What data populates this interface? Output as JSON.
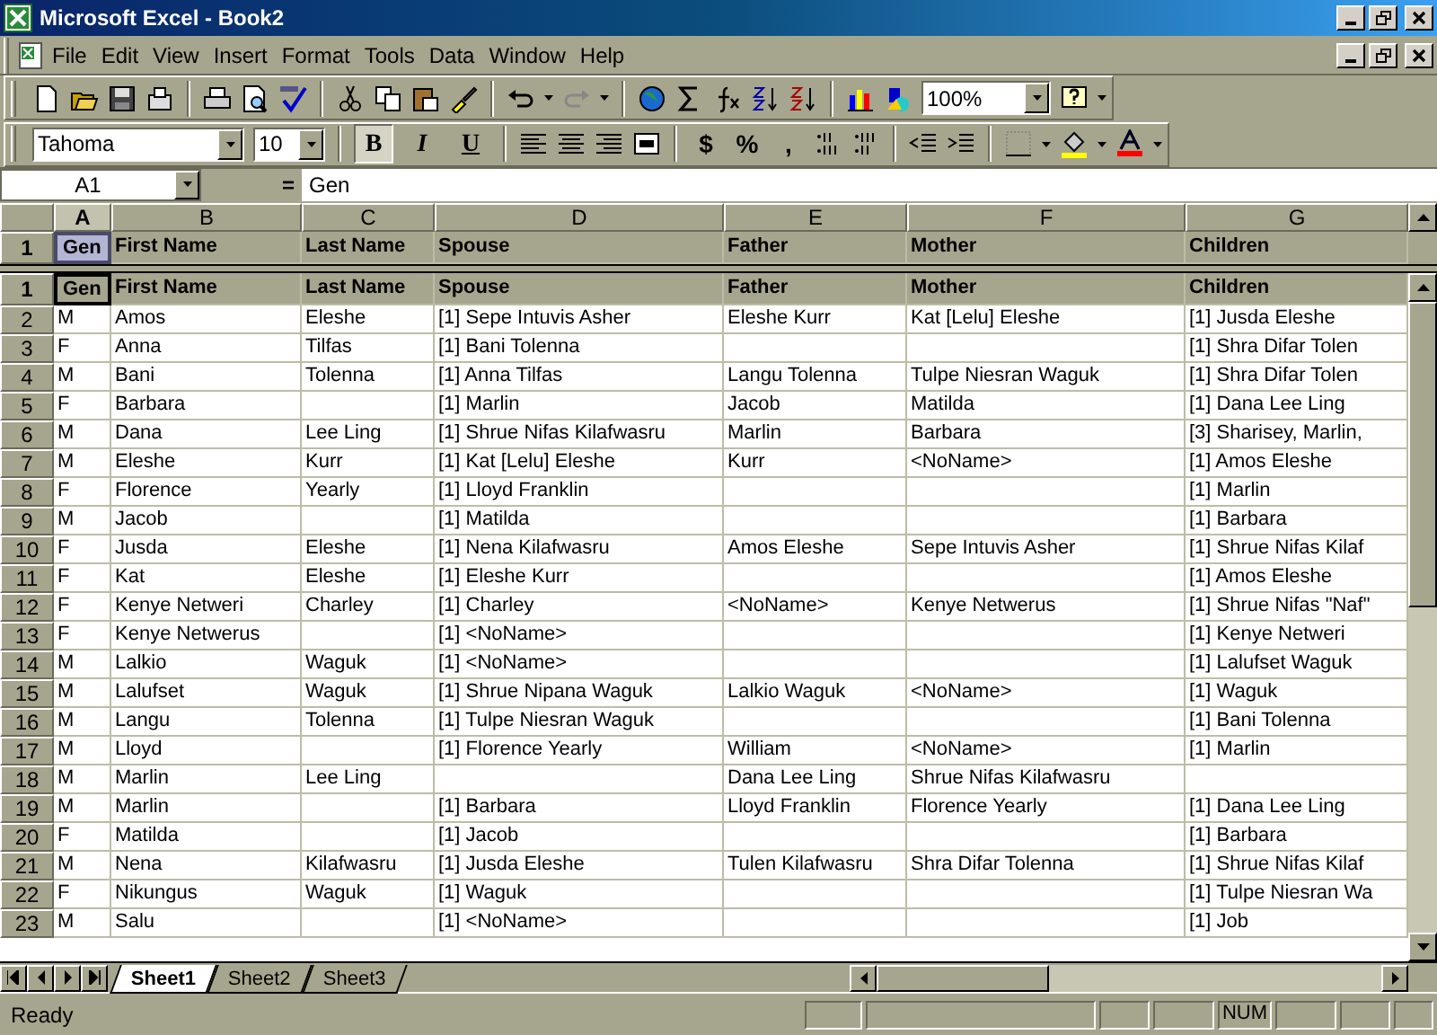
{
  "window": {
    "title": "Microsoft Excel - Book2"
  },
  "menu": {
    "items": [
      "File",
      "Edit",
      "View",
      "Insert",
      "Format",
      "Tools",
      "Data",
      "Window",
      "Help"
    ]
  },
  "standard_toolbar": {
    "zoom": "100%"
  },
  "formatting_toolbar": {
    "font": "Tahoma",
    "size": "10",
    "style_buttons": [
      {
        "label": "B",
        "kind": "bold",
        "selected": true
      },
      {
        "label": "I",
        "kind": "italic",
        "selected": false
      },
      {
        "label": "U",
        "kind": "underline",
        "selected": false
      }
    ],
    "number_buttons": [
      "$",
      "%",
      ","
    ]
  },
  "formula_bar": {
    "name_box": "A1",
    "equals": "=",
    "value": "Gen"
  },
  "columns": [
    {
      "label": "A",
      "selected": true
    },
    {
      "label": "B",
      "selected": false
    },
    {
      "label": "C",
      "selected": false
    },
    {
      "label": "D",
      "selected": false
    },
    {
      "label": "E",
      "selected": false
    },
    {
      "label": "F",
      "selected": false
    },
    {
      "label": "G",
      "selected": false
    }
  ],
  "frozen_rows": [
    {
      "number": "1",
      "selected": true,
      "kind": "header",
      "cells": [
        "Gen",
        "First Name",
        "Last Name",
        "Spouse",
        "Father",
        "Mother",
        "Children"
      ]
    }
  ],
  "rows": [
    {
      "number": "1",
      "selected": true,
      "kind": "header",
      "cells": [
        "Gen",
        "First Name",
        "Last Name",
        "Spouse",
        "Father",
        "Mother",
        "Children"
      ]
    },
    {
      "number": "2",
      "selected": false,
      "kind": "data",
      "cells": [
        "M",
        "Amos",
        "Eleshe",
        "[1] Sepe Intuvis Asher",
        "Eleshe Kurr",
        "Kat [Lelu] Eleshe",
        "[1] Jusda Eleshe"
      ]
    },
    {
      "number": "3",
      "selected": false,
      "kind": "data",
      "cells": [
        "F",
        "Anna",
        "Tilfas",
        "[1] Bani Tolenna",
        null,
        null,
        "[1] Shra Difar Tolen"
      ]
    },
    {
      "number": "4",
      "selected": false,
      "kind": "data",
      "cells": [
        "M",
        "Bani",
        "Tolenna",
        "[1] Anna Tilfas",
        "Langu Tolenna",
        "Tulpe Niesran Waguk",
        "[1] Shra Difar Tolen"
      ]
    },
    {
      "number": "5",
      "selected": false,
      "kind": "data",
      "cells": [
        "F",
        "Barbara",
        null,
        "[1] Marlin",
        "Jacob",
        "Matilda",
        "[1] Dana Lee Ling"
      ]
    },
    {
      "number": "6",
      "selected": false,
      "kind": "data",
      "cells": [
        "M",
        "Dana",
        "Lee Ling",
        "[1] Shrue Nifas Kilafwasru",
        "Marlin",
        "Barbara",
        "[3] Sharisey, Marlin,"
      ]
    },
    {
      "number": "7",
      "selected": false,
      "kind": "data",
      "cells": [
        "M",
        "Eleshe",
        "Kurr",
        "[1] Kat [Lelu] Eleshe",
        "Kurr",
        "<NoName>",
        "[1] Amos Eleshe"
      ]
    },
    {
      "number": "8",
      "selected": false,
      "kind": "data",
      "cells": [
        "F",
        "Florence",
        "Yearly",
        "[1] Lloyd Franklin",
        null,
        null,
        "[1] Marlin"
      ]
    },
    {
      "number": "9",
      "selected": false,
      "kind": "data",
      "cells": [
        "M",
        "Jacob",
        null,
        "[1] Matilda",
        null,
        null,
        "[1] Barbara"
      ]
    },
    {
      "number": "10",
      "selected": false,
      "kind": "data",
      "cells": [
        "F",
        "Jusda",
        "Eleshe",
        "[1] Nena Kilafwasru",
        "Amos Eleshe",
        "Sepe Intuvis Asher",
        "[1] Shrue Nifas Kilaf"
      ]
    },
    {
      "number": "11",
      "selected": false,
      "kind": "data",
      "cells": [
        "F",
        "Kat",
        "Eleshe",
        "[1] Eleshe Kurr",
        null,
        null,
        "[1] Amos Eleshe"
      ]
    },
    {
      "number": "12",
      "selected": false,
      "kind": "data",
      "cells": [
        "F",
        "Kenye Netweri",
        "Charley",
        "[1] Charley",
        "<NoName>",
        "Kenye Netwerus",
        "[1] Shrue Nifas \"Naf\""
      ]
    },
    {
      "number": "13",
      "selected": false,
      "kind": "data",
      "cells": [
        "F",
        "Kenye Netwerus",
        null,
        "[1] <NoName>",
        null,
        null,
        "[1] Kenye Netweri"
      ]
    },
    {
      "number": "14",
      "selected": false,
      "kind": "data",
      "cells": [
        "M",
        "Lalkio",
        "Waguk",
        "[1] <NoName>",
        null,
        null,
        "[1] Lalufset Waguk"
      ]
    },
    {
      "number": "15",
      "selected": false,
      "kind": "data",
      "cells": [
        "M",
        "Lalufset",
        "Waguk",
        "[1] Shrue Nipana Waguk",
        "Lalkio Waguk",
        "<NoName>",
        "[1] Waguk"
      ]
    },
    {
      "number": "16",
      "selected": false,
      "kind": "data",
      "cells": [
        "M",
        "Langu",
        "Tolenna",
        "[1] Tulpe Niesran Waguk",
        null,
        null,
        "[1] Bani Tolenna"
      ]
    },
    {
      "number": "17",
      "selected": false,
      "kind": "data",
      "cells": [
        "M",
        "Lloyd",
        null,
        "[1] Florence Yearly",
        "William",
        "<NoName>",
        "[1] Marlin"
      ]
    },
    {
      "number": "18",
      "selected": false,
      "kind": "data",
      "cells": [
        "M",
        "Marlin",
        "Lee Ling",
        null,
        "Dana Lee Ling",
        "Shrue Nifas Kilafwasru",
        null
      ]
    },
    {
      "number": "19",
      "selected": false,
      "kind": "data",
      "cells": [
        "M",
        "Marlin",
        null,
        "[1] Barbara",
        "Lloyd Franklin",
        "Florence Yearly",
        "[1] Dana Lee Ling"
      ]
    },
    {
      "number": "20",
      "selected": false,
      "kind": "data",
      "cells": [
        "F",
        "Matilda",
        null,
        "[1] Jacob",
        null,
        null,
        "[1] Barbara"
      ]
    },
    {
      "number": "21",
      "selected": false,
      "kind": "data",
      "cells": [
        "M",
        "Nena",
        "Kilafwasru",
        "[1] Jusda Eleshe",
        "Tulen Kilafwasru",
        "Shra Difar Tolenna",
        "[1] Shrue Nifas Kilaf"
      ]
    },
    {
      "number": "22",
      "selected": false,
      "kind": "data",
      "cells": [
        "F",
        "Nikungus",
        "Waguk",
        "[1] Waguk",
        null,
        null,
        "[1] Tulpe Niesran Wa"
      ]
    },
    {
      "number": "23",
      "selected": false,
      "kind": "data",
      "cells": [
        "M",
        "Salu",
        null,
        "[1] <NoName>",
        null,
        null,
        "[1] Job"
      ]
    }
  ],
  "sheet_tabs": [
    {
      "label": "Sheet1",
      "selected": true
    },
    {
      "label": "Sheet2",
      "selected": false
    },
    {
      "label": "Sheet3",
      "selected": false
    }
  ],
  "status_bar": {
    "message": "Ready",
    "indicator": "NUM"
  }
}
